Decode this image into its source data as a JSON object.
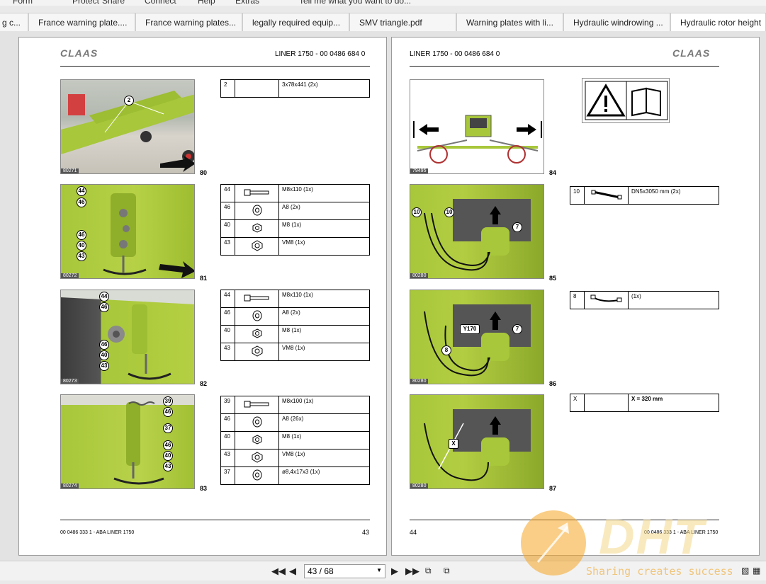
{
  "menu": [
    "Form",
    "Protect",
    "Share",
    "Connect",
    "Help",
    "Extras",
    "Tell me what you want to do..."
  ],
  "tabs": [
    {
      "label": "g c..."
    },
    {
      "label": "France warning plate...."
    },
    {
      "label": "France warning plates..."
    },
    {
      "label": "legally required equip..."
    },
    {
      "label": "SMV triangle.pdf"
    },
    {
      "label": "Warning plates with li..."
    },
    {
      "label": "Hydraulic windrowing ..."
    },
    {
      "label": "Hydraulic rotor height"
    }
  ],
  "left_page": {
    "brand": "CLAAS",
    "doc_title": "LINER 1750 - 00 0486 684 0",
    "figures": [
      {
        "fig": "80",
        "ref": "80271",
        "callouts": [
          "2"
        ],
        "parts": [
          {
            "num": "2",
            "icon": "",
            "desc": "3x78x441 (2x)"
          }
        ]
      },
      {
        "fig": "81",
        "ref": "80272",
        "callouts": [
          "44",
          "46",
          "46",
          "40",
          "43"
        ],
        "parts": [
          {
            "num": "44",
            "icon": "bolt-icon",
            "desc": "M8x110 (1x)"
          },
          {
            "num": "46",
            "icon": "washer-icon",
            "desc": "A8 (2x)"
          },
          {
            "num": "40",
            "icon": "nut-icon",
            "desc": "M8 (1x)"
          },
          {
            "num": "43",
            "icon": "locknut-icon",
            "desc": "VM8 (1x)"
          }
        ]
      },
      {
        "fig": "82",
        "ref": "80273",
        "callouts": [
          "44",
          "46",
          "46",
          "40",
          "43"
        ],
        "parts": [
          {
            "num": "44",
            "icon": "bolt-icon",
            "desc": "M8x110 (1x)"
          },
          {
            "num": "46",
            "icon": "washer-icon",
            "desc": "A8 (2x)"
          },
          {
            "num": "40",
            "icon": "nut-icon",
            "desc": "M8 (1x)"
          },
          {
            "num": "43",
            "icon": "locknut-icon",
            "desc": "VM8 (1x)"
          }
        ]
      },
      {
        "fig": "83",
        "ref": "80274",
        "callouts": [
          "39",
          "46",
          "37",
          "46",
          "40",
          "43"
        ],
        "parts": [
          {
            "num": "39",
            "icon": "bolt-icon",
            "desc": "M8x100 (1x)"
          },
          {
            "num": "46",
            "icon": "washer-icon",
            "desc": "A8 (26x)"
          },
          {
            "num": "40",
            "icon": "nut-icon",
            "desc": "M8 (1x)"
          },
          {
            "num": "43",
            "icon": "locknut-icon",
            "desc": "VM8 (1x)"
          },
          {
            "num": "37",
            "icon": "washer-icon",
            "desc": "ø8,4x17x3 (1x)"
          }
        ]
      }
    ],
    "footer": "00 0486 333 1 - ABA LINER 1750",
    "page_number": "43"
  },
  "right_page": {
    "brand": "CLAAS",
    "doc_title": "LINER 1750 - 00 0486 684 0",
    "figures": [
      {
        "fig": "84",
        "ref": "79495",
        "callouts": []
      },
      {
        "fig": "85",
        "ref": "80280",
        "callouts": [
          "10",
          "10",
          "7"
        ],
        "parts": [
          {
            "num": "10",
            "icon": "hose-icon",
            "desc": "DN5x3050 mm (2x)"
          }
        ]
      },
      {
        "fig": "86",
        "ref": "80280",
        "callouts": [
          "Y170",
          "7",
          "8"
        ],
        "parts": [
          {
            "num": "8",
            "icon": "cable-icon",
            "desc": "(1x)"
          }
        ]
      },
      {
        "fig": "87",
        "ref": "80280",
        "callouts": [
          "X"
        ],
        "parts": [
          {
            "num": "X",
            "icon": "",
            "desc": "X = 320 mm"
          }
        ]
      }
    ],
    "footer": "00 0486 333 1 - ABA LINER 1750",
    "page_number": "44"
  },
  "navigation": {
    "page_indicator": "43 / 68"
  },
  "watermark": {
    "brand": "DHT",
    "slogan": "Sharing creates success"
  },
  "colors": {
    "machine_green": "#a8c73a",
    "accent_orange": "#f0a020"
  }
}
